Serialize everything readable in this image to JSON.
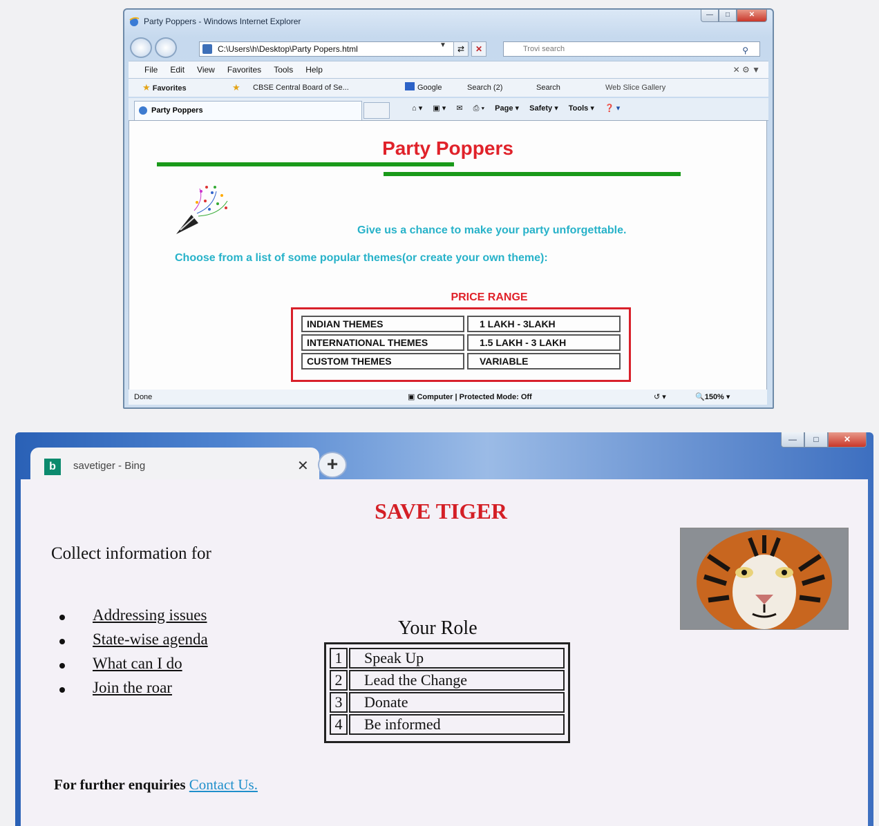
{
  "ie": {
    "title": "Party Poppers - Windows Internet Explorer",
    "address": "C:\\Users\\h\\Desktop\\Party Popers.html",
    "search_placeholder": "Trovi search",
    "menu": [
      "File",
      "Edit",
      "View",
      "Favorites",
      "Tools",
      "Help"
    ],
    "favorites_label": "Favorites",
    "fav_items": [
      "CBSE Central Board of Se...",
      "Google",
      "Search (2)",
      "Search",
      "Web Slice Gallery"
    ],
    "tab_title": "Party Poppers",
    "commands": [
      "Page",
      "Safety",
      "Tools"
    ],
    "status_left": "Done",
    "status_mode": "Computer | Protected Mode: Off",
    "zoom": "150%",
    "page": {
      "title": "Party Poppers",
      "tagline": "Give us a chance to make your party unforgettable.",
      "choose": "Choose from a list of some popular themes(or create your own theme):",
      "price_heading": "PRICE RANGE",
      "price_rows": [
        {
          "theme": "INDIAN THEMES",
          "price": "1 LAKH - 3LAKH"
        },
        {
          "theme": "INTERNATIONAL THEMES",
          "price": "1.5 LAKH - 3 LAKH"
        },
        {
          "theme": "CUSTOM THEMES",
          "price": "VARIABLE"
        }
      ]
    }
  },
  "chrome": {
    "tab_title": "savetiger - Bing",
    "page": {
      "title": "SAVE TIGER",
      "collect": "Collect information for",
      "links": [
        "Addressing issues",
        "State-wise agenda",
        "What can I do",
        "Join the roar"
      ],
      "role_heading": "Your Role",
      "roles": [
        {
          "num": "1",
          "label": "Speak Up"
        },
        {
          "num": "2",
          "label": "Lead the Change"
        },
        {
          "num": "3",
          "label": "Donate"
        },
        {
          "num": "4",
          "label": "Be informed"
        }
      ],
      "further_text": "For further enquiries",
      "contact_link": "Contact Us."
    }
  },
  "colors": {
    "title_red": "#e0222a",
    "accent_cyan": "#27b2c9",
    "rule_green": "#1a9a1a",
    "link_blue": "#1f8fcb"
  }
}
